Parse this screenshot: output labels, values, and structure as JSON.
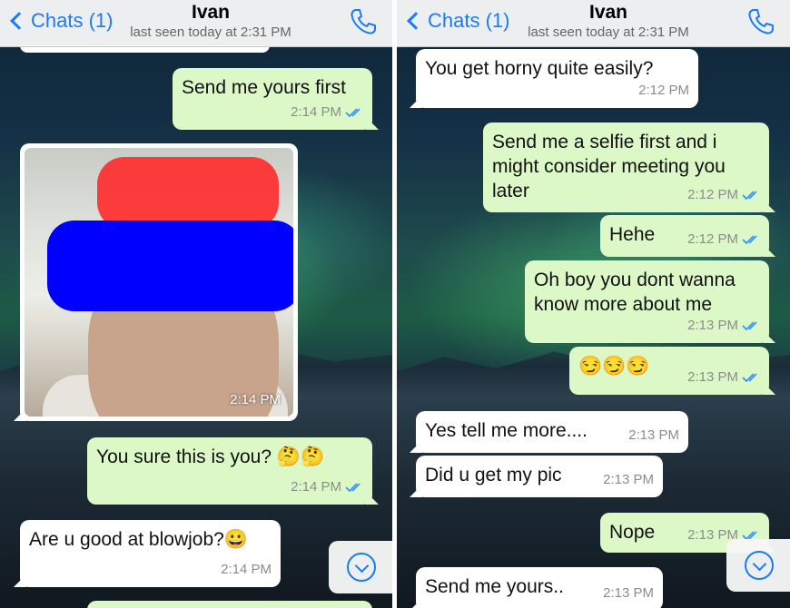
{
  "left": {
    "header": {
      "back_label": "Chats (1)",
      "name": "Ivan",
      "status": "last seen today at 2:31 PM"
    },
    "messages": [
      {
        "text": "Send me yours first",
        "time": "2:14 PM"
      },
      {
        "time": "2:14 PM"
      },
      {
        "text": "You sure this is you? 🤔🤔",
        "time": "2:14 PM"
      },
      {
        "text": "Are u good at blowjob?😀",
        "time": "2:14 PM"
      }
    ]
  },
  "right": {
    "header": {
      "back_label": "Chats (1)",
      "name": "Ivan",
      "status": "last seen today at 2:31 PM"
    },
    "messages": [
      {
        "text": "You get horny quite easily?",
        "time": "2:12 PM"
      },
      {
        "text": "Send me a selfie first and i might consider meeting you later",
        "time": "2:12 PM"
      },
      {
        "text": "Hehe",
        "time": "2:12 PM"
      },
      {
        "text": "Oh boy you dont wanna know more about me",
        "time": "2:13 PM"
      },
      {
        "text": "😏😏😏",
        "time": "2:13 PM"
      },
      {
        "text": "Yes tell me more....",
        "time": "2:13 PM"
      },
      {
        "text": "Did u get my pic",
        "time": "2:13 PM"
      },
      {
        "text": "Nope",
        "time": "2:13 PM"
      },
      {
        "text": "Send me yours..",
        "time": "2:13 PM"
      }
    ]
  },
  "colors": {
    "accent": "#1a7cf3",
    "outgoing": "#dcf8c6",
    "incoming": "#ffffff"
  }
}
